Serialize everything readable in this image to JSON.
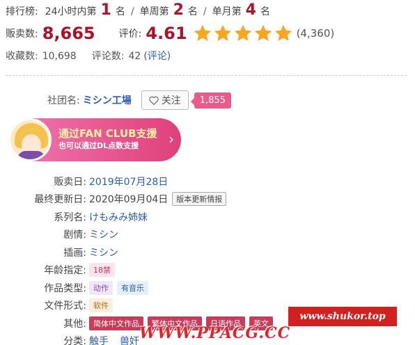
{
  "ranking": {
    "label": "排行榜:",
    "day_label": "24小时内第",
    "day_rank": "1",
    "day_suffix": "名",
    "week_label": "单周第",
    "week_rank": "2",
    "week_suffix": "名",
    "month_label": "单月第",
    "month_rank": "4",
    "month_suffix": "名",
    "separator": "/"
  },
  "sales": {
    "label": "贩卖数:",
    "value": "8,665"
  },
  "rating": {
    "label": "评价:",
    "value": "4.61",
    "stars": 5,
    "count": "(4,360)",
    "star_color": "#f5a623"
  },
  "favorites": {
    "label": "收藏数:",
    "value": "10,698",
    "reviews_label": "评论数:",
    "reviews_value": "42",
    "reviews_link": "(评论)"
  },
  "circle": {
    "label": "社团名:",
    "name": "ミシン工場",
    "follow_label": "关注",
    "follow_count": "1,855"
  },
  "fanclub": {
    "title": "通过FAN CLUB支援",
    "subtitle": "也可以通过DL点数支援",
    "arrow": "›"
  },
  "info": {
    "release": {
      "label": "贩卖日:",
      "value": "2019年07月28日"
    },
    "updated": {
      "label": "最终更新日:",
      "value": "2020年09月04日",
      "button": "版本更新情报"
    },
    "series": {
      "label": "系列名:",
      "value": "けもみみ姉妹"
    },
    "scenario": {
      "label": "剧情:",
      "value": "ミシン"
    },
    "illust": {
      "label": "插画:",
      "value": "ミシン"
    },
    "age": {
      "label": "年龄指定:",
      "value": "18禁"
    },
    "type": {
      "label": "作品类型:",
      "tags": [
        "动作",
        "有音乐"
      ]
    },
    "format": {
      "label": "文件形式:",
      "value": "软件"
    },
    "other": {
      "label": "其他:",
      "tags": [
        "简体中文作品",
        "繁体中文作品",
        "日语作品",
        "英文"
      ]
    },
    "genre": {
      "label": "分类:",
      "items": [
        "触手",
        "兽奸"
      ]
    }
  },
  "watermarks": {
    "right": "www.shukor.top",
    "bottom": "WWW.PPACG.CC"
  },
  "colors": {
    "accent_red": "#a8142a",
    "link_blue": "#2a5db0",
    "pink": "#e85b8a"
  }
}
